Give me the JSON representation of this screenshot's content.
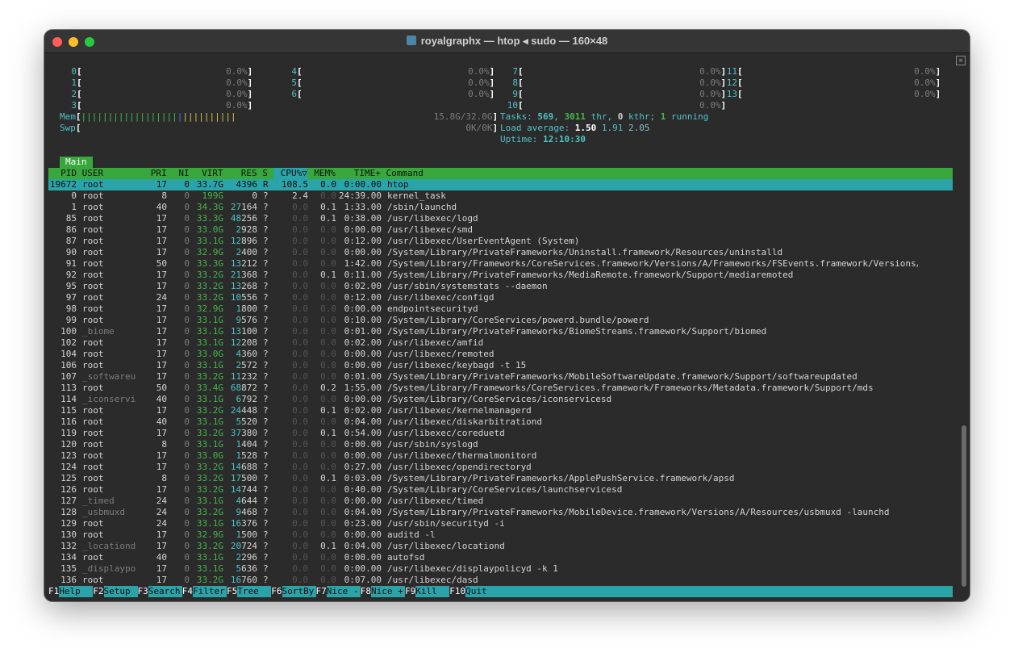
{
  "window": {
    "title": "royalgraphx — htop ◂ sudo — 160×48"
  },
  "meters": {
    "cpus": [
      {
        "id": "0",
        "val": "0.0%"
      },
      {
        "id": "1",
        "val": "0.0%"
      },
      {
        "id": "2",
        "val": "0.0%"
      },
      {
        "id": "3",
        "val": "0.0%"
      },
      {
        "id": "4",
        "val": "0.0%"
      },
      {
        "id": "5",
        "val": "0.0%"
      },
      {
        "id": "6",
        "val": "0.0%"
      },
      {
        "id": "7",
        "val": "0.0%"
      },
      {
        "id": "8",
        "val": "0.0%"
      },
      {
        "id": "9",
        "val": "0.0%"
      },
      {
        "id": "10",
        "val": "0.0%"
      },
      {
        "id": "11",
        "val": "0.0%"
      },
      {
        "id": "12",
        "val": "0.0%"
      },
      {
        "id": "13",
        "val": "0.0%"
      }
    ],
    "mem": {
      "label": "Mem",
      "value": "15.8G/32.0G",
      "used_fraction": 0.49
    },
    "swp": {
      "label": "Swp",
      "value": "0K/0K"
    },
    "tasks": {
      "label": "Tasks:",
      "total": "569",
      "threads": "3011",
      "thr": "thr,",
      "kthr": "0",
      "kthr_label": "kthr;",
      "running": "1",
      "running_label": "running"
    },
    "load": {
      "label": "Load average:",
      "l1": "1.50",
      "l5": "1.91",
      "l15": "2.05"
    },
    "uptime": {
      "label": "Uptime:",
      "value": "12:10:30"
    }
  },
  "tabs": {
    "main": "Main"
  },
  "columns": {
    "pid": "PID",
    "user": "USER",
    "pri": "PRI",
    "ni": "NI",
    "virt": "VIRT",
    "res": "RES",
    "s": "S",
    "cpu": "CPU%▽",
    "mem": "MEM%",
    "time": "TIME+",
    "cmd": "Command"
  },
  "processes": [
    {
      "pid": "19672",
      "user": "root",
      "pri": "17",
      "ni": "0",
      "virt": "33.7G",
      "res": "4396",
      "s": "R",
      "cpu": "108.5",
      "mem": "0.0",
      "time": "0:00.00",
      "cmd": "htop"
    },
    {
      "pid": "0",
      "user": "root",
      "pri": "8",
      "ni": "0",
      "virt": "199G",
      "res": "0",
      "s": "?",
      "cpu": "2.4",
      "mem": "0.0",
      "time": "24:39.00",
      "cmd": "kernel_task"
    },
    {
      "pid": "1",
      "user": "root",
      "pri": "40",
      "ni": "0",
      "virt": "34.3G",
      "res": "27164",
      "s": "?",
      "cpu": "0.0",
      "mem": "0.1",
      "time": "1:33.00",
      "cmd": "/sbin/launchd"
    },
    {
      "pid": "85",
      "user": "root",
      "pri": "17",
      "ni": "0",
      "virt": "33.3G",
      "res": "48256",
      "s": "?",
      "cpu": "0.0",
      "mem": "0.1",
      "time": "0:38.00",
      "cmd": "/usr/libexec/logd"
    },
    {
      "pid": "86",
      "user": "root",
      "pri": "17",
      "ni": "0",
      "virt": "33.0G",
      "res": "2928",
      "s": "?",
      "cpu": "0.0",
      "mem": "0.0",
      "time": "0:00.00",
      "cmd": "/usr/libexec/smd"
    },
    {
      "pid": "87",
      "user": "root",
      "pri": "17",
      "ni": "0",
      "virt": "33.1G",
      "res": "12896",
      "s": "?",
      "cpu": "0.0",
      "mem": "0.0",
      "time": "0:12.00",
      "cmd": "/usr/libexec/UserEventAgent (System)"
    },
    {
      "pid": "90",
      "user": "root",
      "pri": "17",
      "ni": "0",
      "virt": "32.9G",
      "res": "2400",
      "s": "?",
      "cpu": "0.0",
      "mem": "0.0",
      "time": "0:00.00",
      "cmd": "/System/Library/PrivateFrameworks/Uninstall.framework/Resources/uninstalld"
    },
    {
      "pid": "91",
      "user": "root",
      "pri": "50",
      "ni": "0",
      "virt": "33.3G",
      "res": "13212",
      "s": "?",
      "cpu": "0.0",
      "mem": "0.0",
      "time": "1:42.00",
      "cmd": "/System/Library/Frameworks/CoreServices.framework/Versions/A/Frameworks/FSEvents.framework/Versions/A"
    },
    {
      "pid": "92",
      "user": "root",
      "pri": "17",
      "ni": "0",
      "virt": "33.2G",
      "res": "21368",
      "s": "?",
      "cpu": "0.0",
      "mem": "0.1",
      "time": "0:11.00",
      "cmd": "/System/Library/PrivateFrameworks/MediaRemote.framework/Support/mediaremoted"
    },
    {
      "pid": "95",
      "user": "root",
      "pri": "17",
      "ni": "0",
      "virt": "33.2G",
      "res": "13268",
      "s": "?",
      "cpu": "0.0",
      "mem": "0.0",
      "time": "0:02.00",
      "cmd": "/usr/sbin/systemstats --daemon"
    },
    {
      "pid": "97",
      "user": "root",
      "pri": "24",
      "ni": "0",
      "virt": "33.2G",
      "res": "10556",
      "s": "?",
      "cpu": "0.0",
      "mem": "0.0",
      "time": "0:12.00",
      "cmd": "/usr/libexec/configd"
    },
    {
      "pid": "98",
      "user": "root",
      "pri": "17",
      "ni": "0",
      "virt": "32.9G",
      "res": "1800",
      "s": "?",
      "cpu": "0.0",
      "mem": "0.0",
      "time": "0:00.00",
      "cmd": "endpointsecurityd"
    },
    {
      "pid": "99",
      "user": "root",
      "pri": "17",
      "ni": "0",
      "virt": "33.1G",
      "res": "9576",
      "s": "?",
      "cpu": "0.0",
      "mem": "0.0",
      "time": "0:10.00",
      "cmd": "/System/Library/CoreServices/powerd.bundle/powerd"
    },
    {
      "pid": "100",
      "user": "_biome",
      "pri": "17",
      "ni": "0",
      "virt": "33.1G",
      "res": "13100",
      "s": "?",
      "cpu": "0.0",
      "mem": "0.0",
      "time": "0:01.00",
      "cmd": "/System/Library/PrivateFrameworks/BiomeStreams.framework/Support/biomed"
    },
    {
      "pid": "102",
      "user": "root",
      "pri": "17",
      "ni": "0",
      "virt": "33.1G",
      "res": "12208",
      "s": "?",
      "cpu": "0.0",
      "mem": "0.0",
      "time": "0:02.00",
      "cmd": "/usr/libexec/amfid"
    },
    {
      "pid": "104",
      "user": "root",
      "pri": "17",
      "ni": "0",
      "virt": "33.0G",
      "res": "4360",
      "s": "?",
      "cpu": "0.0",
      "mem": "0.0",
      "time": "0:00.00",
      "cmd": "/usr/libexec/remoted"
    },
    {
      "pid": "106",
      "user": "root",
      "pri": "17",
      "ni": "0",
      "virt": "33.1G",
      "res": "2572",
      "s": "?",
      "cpu": "0.0",
      "mem": "0.0",
      "time": "0:00.00",
      "cmd": "/usr/libexec/keybagd -t 15"
    },
    {
      "pid": "107",
      "user": "_softwareu",
      "pri": "17",
      "ni": "0",
      "virt": "33.2G",
      "res": "11232",
      "s": "?",
      "cpu": "0.0",
      "mem": "0.0",
      "time": "0:01.00",
      "cmd": "/System/Library/PrivateFrameworks/MobileSoftwareUpdate.framework/Support/softwareupdated"
    },
    {
      "pid": "113",
      "user": "root",
      "pri": "50",
      "ni": "0",
      "virt": "33.4G",
      "res": "68872",
      "s": "?",
      "cpu": "0.0",
      "mem": "0.2",
      "time": "1:55.00",
      "cmd": "/System/Library/Frameworks/CoreServices.framework/Frameworks/Metadata.framework/Support/mds"
    },
    {
      "pid": "114",
      "user": "_iconservi",
      "pri": "40",
      "ni": "0",
      "virt": "33.1G",
      "res": "6792",
      "s": "?",
      "cpu": "0.0",
      "mem": "0.0",
      "time": "0:00.00",
      "cmd": "/System/Library/CoreServices/iconservicesd"
    },
    {
      "pid": "115",
      "user": "root",
      "pri": "17",
      "ni": "0",
      "virt": "33.2G",
      "res": "24448",
      "s": "?",
      "cpu": "0.0",
      "mem": "0.1",
      "time": "0:02.00",
      "cmd": "/usr/libexec/kernelmanagerd"
    },
    {
      "pid": "116",
      "user": "root",
      "pri": "40",
      "ni": "0",
      "virt": "33.1G",
      "res": "5520",
      "s": "?",
      "cpu": "0.0",
      "mem": "0.0",
      "time": "0:04.00",
      "cmd": "/usr/libexec/diskarbitrationd"
    },
    {
      "pid": "119",
      "user": "root",
      "pri": "17",
      "ni": "0",
      "virt": "33.2G",
      "res": "37380",
      "s": "?",
      "cpu": "0.0",
      "mem": "0.1",
      "time": "0:54.00",
      "cmd": "/usr/libexec/coreduetd"
    },
    {
      "pid": "120",
      "user": "root",
      "pri": "8",
      "ni": "0",
      "virt": "33.1G",
      "res": "1404",
      "s": "?",
      "cpu": "0.0",
      "mem": "0.0",
      "time": "0:00.00",
      "cmd": "/usr/sbin/syslogd"
    },
    {
      "pid": "123",
      "user": "root",
      "pri": "17",
      "ni": "0",
      "virt": "33.0G",
      "res": "1528",
      "s": "?",
      "cpu": "0.0",
      "mem": "0.0",
      "time": "0:00.00",
      "cmd": "/usr/libexec/thermalmonitord"
    },
    {
      "pid": "124",
      "user": "root",
      "pri": "17",
      "ni": "0",
      "virt": "33.2G",
      "res": "14688",
      "s": "?",
      "cpu": "0.0",
      "mem": "0.0",
      "time": "0:27.00",
      "cmd": "/usr/libexec/opendirectoryd"
    },
    {
      "pid": "125",
      "user": "root",
      "pri": "8",
      "ni": "0",
      "virt": "33.2G",
      "res": "17500",
      "s": "?",
      "cpu": "0.0",
      "mem": "0.1",
      "time": "0:03.00",
      "cmd": "/System/Library/PrivateFrameworks/ApplePushService.framework/apsd"
    },
    {
      "pid": "126",
      "user": "root",
      "pri": "17",
      "ni": "0",
      "virt": "33.2G",
      "res": "14744",
      "s": "?",
      "cpu": "0.0",
      "mem": "0.0",
      "time": "0:40.00",
      "cmd": "/System/Library/CoreServices/launchservicesd"
    },
    {
      "pid": "127",
      "user": "_timed",
      "pri": "24",
      "ni": "0",
      "virt": "33.1G",
      "res": "4644",
      "s": "?",
      "cpu": "0.0",
      "mem": "0.0",
      "time": "0:00.00",
      "cmd": "/usr/libexec/timed"
    },
    {
      "pid": "128",
      "user": "_usbmuxd",
      "pri": "24",
      "ni": "0",
      "virt": "33.2G",
      "res": "9468",
      "s": "?",
      "cpu": "0.0",
      "mem": "0.0",
      "time": "0:04.00",
      "cmd": "/System/Library/PrivateFrameworks/MobileDevice.framework/Versions/A/Resources/usbmuxd -launchd"
    },
    {
      "pid": "129",
      "user": "root",
      "pri": "24",
      "ni": "0",
      "virt": "33.1G",
      "res": "16376",
      "s": "?",
      "cpu": "0.0",
      "mem": "0.0",
      "time": "0:23.00",
      "cmd": "/usr/sbin/securityd -i"
    },
    {
      "pid": "130",
      "user": "root",
      "pri": "17",
      "ni": "0",
      "virt": "32.9G",
      "res": "1500",
      "s": "?",
      "cpu": "0.0",
      "mem": "0.0",
      "time": "0:00.00",
      "cmd": "auditd -l"
    },
    {
      "pid": "132",
      "user": "_locationd",
      "pri": "17",
      "ni": "0",
      "virt": "33.2G",
      "res": "20724",
      "s": "?",
      "cpu": "0.0",
      "mem": "0.1",
      "time": "0:04.00",
      "cmd": "/usr/libexec/locationd"
    },
    {
      "pid": "134",
      "user": "root",
      "pri": "40",
      "ni": "0",
      "virt": "33.1G",
      "res": "2296",
      "s": "?",
      "cpu": "0.0",
      "mem": "0.0",
      "time": "0:00.00",
      "cmd": "autofsd"
    },
    {
      "pid": "135",
      "user": "_displaypo",
      "pri": "17",
      "ni": "0",
      "virt": "33.1G",
      "res": "5636",
      "s": "?",
      "cpu": "0.0",
      "mem": "0.0",
      "time": "0:00.00",
      "cmd": "/usr/libexec/displaypolicyd -k 1"
    },
    {
      "pid": "136",
      "user": "root",
      "pri": "17",
      "ni": "0",
      "virt": "33.2G",
      "res": "16760",
      "s": "?",
      "cpu": "0.0",
      "mem": "0.0",
      "time": "0:07.00",
      "cmd": "/usr/libexec/dasd"
    }
  ],
  "fkeys": [
    {
      "key": "F1",
      "label": "Help  "
    },
    {
      "key": "F2",
      "label": "Setup "
    },
    {
      "key": "F3",
      "label": "Search"
    },
    {
      "key": "F4",
      "label": "Filter"
    },
    {
      "key": "F5",
      "label": "Tree  "
    },
    {
      "key": "F6",
      "label": "SortBy"
    },
    {
      "key": "F7",
      "label": "Nice -"
    },
    {
      "key": "F8",
      "label": "Nice +"
    },
    {
      "key": "F9",
      "label": "Kill  "
    },
    {
      "key": "F10",
      "label": "Quit"
    }
  ],
  "colors": {
    "accent_cyan": "#2aa3a9",
    "header_green": "#38a83c",
    "text": "#d4d4d4",
    "background": "#2b2b2b"
  }
}
